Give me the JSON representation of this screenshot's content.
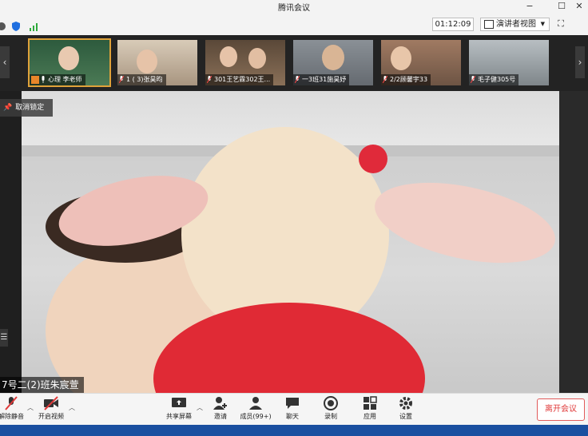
{
  "window": {
    "title": "腾讯会议"
  },
  "status": {
    "timer": "01:12:09",
    "view_label": "演讲者视图"
  },
  "thumbnails": [
    {
      "name": "心理 李老师",
      "bg": "#3a6a4a"
    },
    {
      "name": "1 ( 3)张昊昀",
      "bg": "#b9a78e"
    },
    {
      "name": "301王艺霖302王...",
      "bg": "#6b5a4a"
    },
    {
      "name": "一3班31施昊妤",
      "bg": "#7a7f86"
    },
    {
      "name": "2/2顾馨宇33",
      "bg": "#8a6a5a"
    },
    {
      "name": "毛子健305号",
      "bg": "#9aa0a4"
    }
  ],
  "main": {
    "unpin_label": "取消锁定",
    "speaker_name": "7号二(2)班朱宸萱"
  },
  "toolbar": {
    "unmute": "解除静音",
    "video": "开启视频",
    "share": "共享屏幕",
    "invite": "邀请",
    "members": "成员(99+)",
    "chat": "聊天",
    "record": "录制",
    "apps": "应用",
    "settings": "设置",
    "leave": "离开会议"
  },
  "colors": {
    "accent": "#1f6fe0",
    "danger": "#e03a3a",
    "active_border": "#e0a23a"
  }
}
